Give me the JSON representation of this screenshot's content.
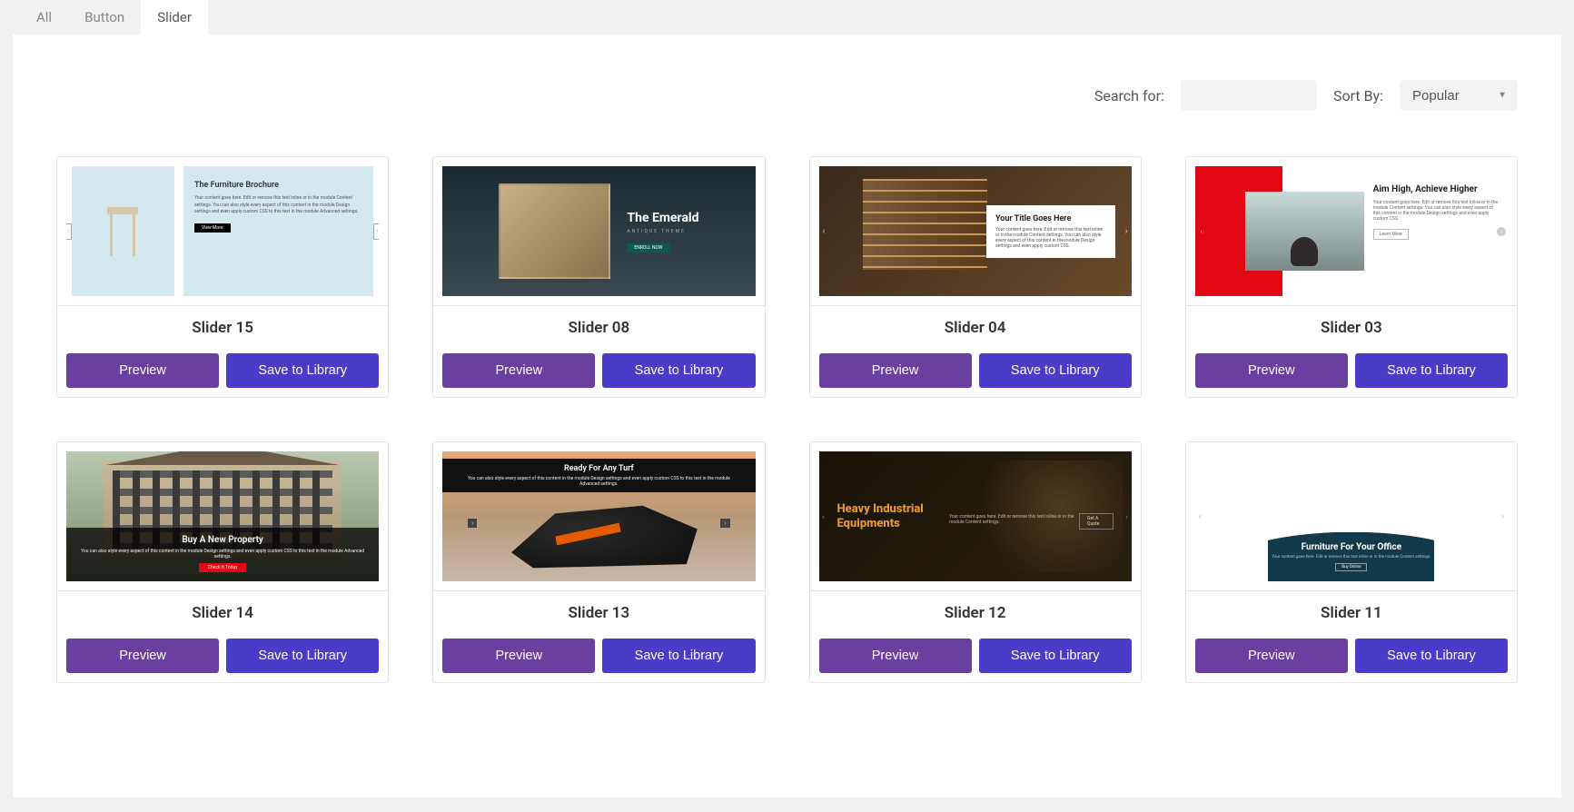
{
  "tabs": [
    {
      "label": "All",
      "active": false
    },
    {
      "label": "Button",
      "active": false
    },
    {
      "label": "Slider",
      "active": true
    }
  ],
  "toolbar": {
    "search_label": "Search for:",
    "search_value": "",
    "sort_label": "Sort By:",
    "sort_value": "Popular"
  },
  "buttons": {
    "preview": "Preview",
    "save": "Save to Library"
  },
  "items": [
    {
      "title": "Slider 15",
      "thumb": {
        "type": "t15",
        "heading": "The Furniture Brochure",
        "para": "Your content goes here. Edit or remove this text inline or in the module Content settings. You can also style every aspect of this content in the module Design settings and even apply custom CSS to this text in the module Advanced settings.",
        "button": "View More"
      }
    },
    {
      "title": "Slider 08",
      "thumb": {
        "type": "t08",
        "heading": "The Emerald",
        "sub": "ANTIQUE THEME",
        "button": "ENROLL NOW"
      }
    },
    {
      "title": "Slider 04",
      "thumb": {
        "type": "t04",
        "heading": "Your Title Goes Here",
        "para": "Your content goes here. Edit or remove this text inline or in the module Content settings. You can also style every aspect of this content in the module Design settings and even apply custom CSS."
      }
    },
    {
      "title": "Slider 03",
      "thumb": {
        "type": "t03",
        "heading": "Aim High, Achieve Higher",
        "para": "Your content goes here. Edit or remove this text inline or in the module Content settings. You can also style every aspect of this content in the module Design settings and even apply custom CSS.",
        "button": "Learn More"
      }
    },
    {
      "title": "Slider 14",
      "thumb": {
        "type": "t14",
        "heading": "Buy A New Property",
        "para": "You can also style every aspect of this content in the module Design settings and even apply custom CSS to this text in the module Advanced settings.",
        "button": "Check It Today"
      }
    },
    {
      "title": "Slider 13",
      "thumb": {
        "type": "t13",
        "heading": "Ready For Any Turf",
        "para": "You can also style every aspect of this content in the module Design settings and even apply custom CSS to this text in the module Advanced settings."
      }
    },
    {
      "title": "Slider 12",
      "thumb": {
        "type": "t12",
        "heading": "Heavy Industrial Equipments",
        "para": "Your content goes here. Edit or remove this text inline or in the module Content settings.",
        "button": "Get A Quote"
      }
    },
    {
      "title": "Slider 11",
      "thumb": {
        "type": "t11",
        "heading": "Furniture For Your Office",
        "para": "Your content goes here. Edit or remove this text inline or in the module Content settings.",
        "button": "Buy Online"
      }
    }
  ]
}
